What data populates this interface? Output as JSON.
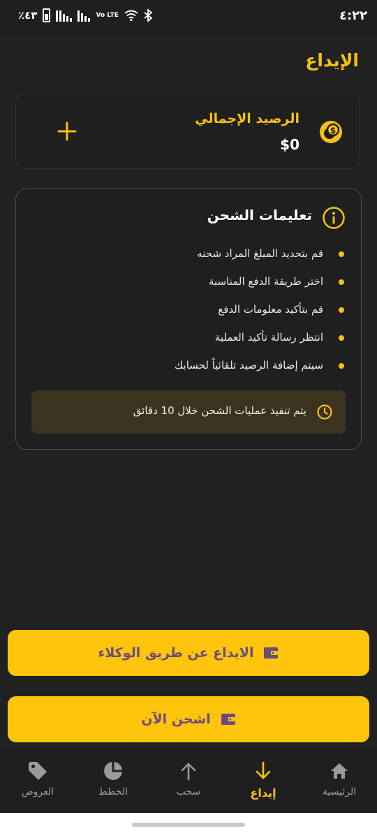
{
  "status_bar": {
    "time": "٤:٢٢",
    "battery": "٪٤٣",
    "network": "Vo LTE"
  },
  "header": {
    "title": "الإيداع"
  },
  "balance": {
    "label": "الرصيد الإجمالي",
    "value": "$0",
    "add_icon": "plus-icon",
    "coin_icon": "coins-icon"
  },
  "instructions": {
    "title": "تعليمات الشحن",
    "steps": [
      "قم بتحديد المبلغ المراد شحنه",
      "اختر طريقة الدفع المناسبة",
      "قم بتأكيد معلومات الدفع",
      "انتظر رسالة تأكيد العملية",
      "سيتم إضافة الرصيد تلقائياً لحسابك"
    ],
    "notice": "يتم تنفيذ عمليات الشحن خلال 10 دقائق"
  },
  "actions": {
    "agents_label": "الايداع عن طريق الوكلاء",
    "charge_label": "اشحن الآن"
  },
  "nav": {
    "items": [
      {
        "label": "الرئيسية",
        "icon": "home-icon"
      },
      {
        "label": "إيداع",
        "icon": "arrow-down-icon",
        "active": true
      },
      {
        "label": "سحب",
        "icon": "arrow-up-icon"
      },
      {
        "label": "الخطط",
        "icon": "pie-chart-icon"
      },
      {
        "label": "العروض",
        "icon": "tag-icon"
      }
    ]
  },
  "colors": {
    "accent": "#f5c211",
    "button": "#ffc40c",
    "button_text": "#6b4c7d",
    "background": "#212121",
    "notice_bg": "#3b331f"
  }
}
